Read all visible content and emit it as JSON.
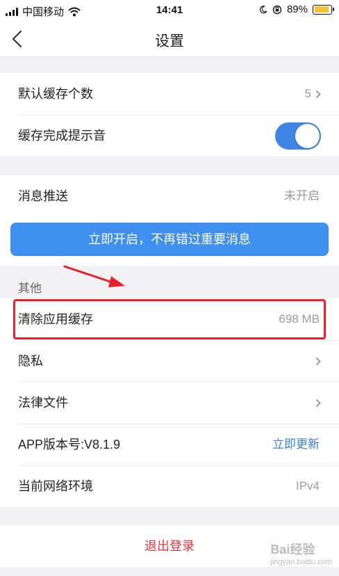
{
  "status_bar": {
    "carrier": "中国移动",
    "time": "14:41",
    "battery_percent": "89%",
    "battery_level": 0.89
  },
  "nav": {
    "title": "设置"
  },
  "settings": {
    "default_cache_count": {
      "label": "默认缓存个数",
      "value": "5"
    },
    "cache_done_sound": {
      "label": "缓存完成提示音",
      "enabled": true
    },
    "push": {
      "label": "消息推送",
      "value": "未开启"
    },
    "enable_push_button": "立即开启，不再错过重要消息",
    "other_section": "其他",
    "clear_cache": {
      "label": "清除应用缓存",
      "value": "698 MB"
    },
    "privacy": {
      "label": "隐私"
    },
    "legal": {
      "label": "法律文件"
    },
    "version": {
      "label": "APP版本号:V8.1.9",
      "action": "立即更新"
    },
    "network": {
      "label": "当前网络环境",
      "value": "IPv4"
    },
    "logout": "退出登录"
  },
  "colors": {
    "accent": "#3f8ff0",
    "toggle_on": "#3d86e5",
    "logout": "#e0383e",
    "highlight": "#e8202a"
  },
  "watermark": {
    "text": "Bai经验",
    "sub": "jingyan.baidu.com"
  }
}
